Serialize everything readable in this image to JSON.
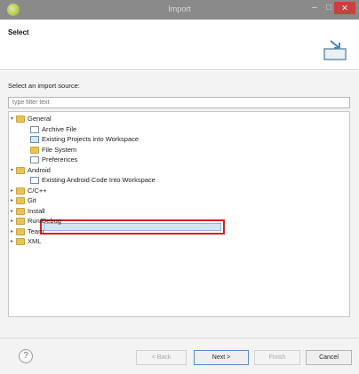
{
  "window": {
    "title": "Import"
  },
  "header": {
    "title": "Select"
  },
  "main": {
    "source_label": "Select an import source:",
    "filter_placeholder": "type filter text",
    "tree": [
      {
        "label": "General",
        "indent": 0,
        "expanded": true,
        "icon": "folder"
      },
      {
        "label": "Archive File",
        "indent": 1,
        "icon": "file"
      },
      {
        "label": "Existing Projects into Workspace",
        "indent": 1,
        "icon": "project"
      },
      {
        "label": "File System",
        "indent": 1,
        "icon": "folder"
      },
      {
        "label": "Preferences",
        "indent": 1,
        "icon": "file"
      },
      {
        "label": "Android",
        "indent": 0,
        "expanded": true,
        "icon": "folder"
      },
      {
        "label": "Existing Android Code Into Workspace",
        "indent": 1,
        "icon": "file",
        "selected": true
      },
      {
        "label": "C/C++",
        "indent": 0,
        "expanded": false,
        "icon": "folder"
      },
      {
        "label": "Git",
        "indent": 0,
        "expanded": false,
        "icon": "folder"
      },
      {
        "label": "Install",
        "indent": 0,
        "expanded": false,
        "icon": "folder"
      },
      {
        "label": "Run/Debug",
        "indent": 0,
        "expanded": false,
        "icon": "folder"
      },
      {
        "label": "Team",
        "indent": 0,
        "expanded": false,
        "icon": "folder"
      },
      {
        "label": "XML",
        "indent": 0,
        "expanded": false,
        "icon": "folder"
      }
    ]
  },
  "footer": {
    "back_label": "< Back",
    "next_label": "Next >",
    "finish_label": "Finish",
    "cancel_label": "Cancel"
  },
  "colors": {
    "selection_outline": "#d62020",
    "selection_fill": "#d3e4f7",
    "close_button": "#c94040"
  }
}
